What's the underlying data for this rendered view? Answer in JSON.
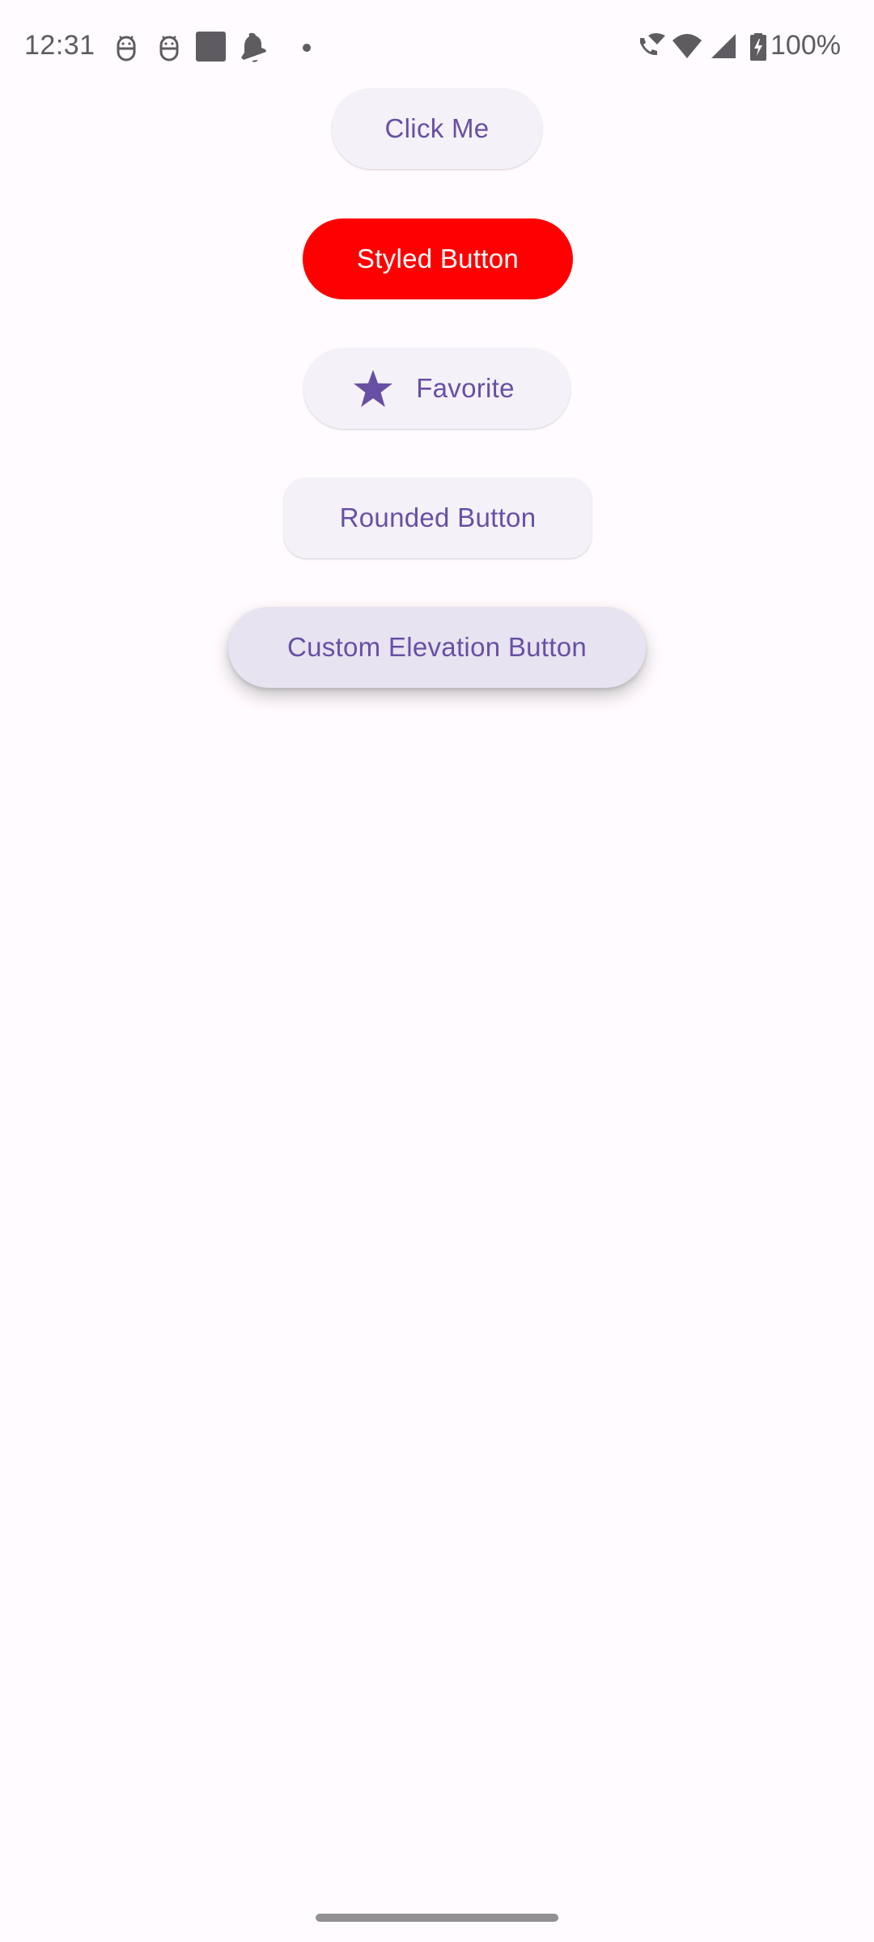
{
  "status_bar": {
    "time": "12:31",
    "left_icons": [
      "android-debug-icon",
      "android-debug-icon",
      "square-app-icon",
      "bell-muted-icon",
      "dot-icon"
    ],
    "right_icons": [
      "wifi-calling-icon",
      "wifi-icon",
      "signal-icon",
      "battery-charging-icon"
    ],
    "battery_percent": "100%"
  },
  "buttons": {
    "click_me": {
      "label": "Click Me"
    },
    "styled": {
      "label": "Styled Button",
      "background": "#ff0000",
      "text_color": "#ffffff"
    },
    "favorite": {
      "label": "Favorite",
      "icon": "star-icon"
    },
    "rounded": {
      "label": "Rounded Button"
    },
    "custom_elevation": {
      "label": "Custom Elevation Button"
    }
  },
  "colors": {
    "primary": "#6750a4",
    "button_surface": "#f5f1f8",
    "elevated_surface": "#e8e3f1",
    "background": "#fffbfe",
    "status_icon": "#5f5c61"
  }
}
